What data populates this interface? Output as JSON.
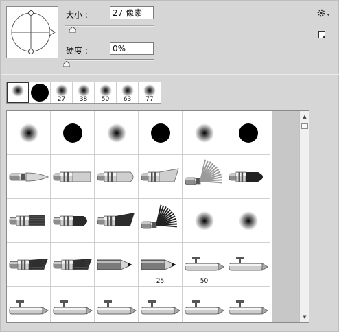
{
  "brush_settings": {
    "size_label": "大小 :",
    "size_value": "27 像素",
    "hardness_label": "硬度 :",
    "hardness_value": "0%",
    "size_slider_fraction": 0.09,
    "hardness_slider_fraction": 0.0
  },
  "icons": {
    "panel_menu": "gear-icon",
    "new_preset": "new-preset-icon"
  },
  "recent_brushes": [
    {
      "kind": "soft",
      "label": "",
      "selected": true
    },
    {
      "kind": "hard",
      "label": ""
    },
    {
      "kind": "soft",
      "label": "27"
    },
    {
      "kind": "soft",
      "label": "38"
    },
    {
      "kind": "soft",
      "label": "50"
    },
    {
      "kind": "soft",
      "label": "63"
    },
    {
      "kind": "soft",
      "label": "77"
    }
  ],
  "presets": [
    {
      "kind": "soft",
      "label": ""
    },
    {
      "kind": "hard",
      "label": ""
    },
    {
      "kind": "soft",
      "label": ""
    },
    {
      "kind": "hard",
      "label": ""
    },
    {
      "kind": "soft",
      "label": ""
    },
    {
      "kind": "hard",
      "label": ""
    },
    {
      "kind": "round-point",
      "label": ""
    },
    {
      "kind": "flat-brush",
      "label": ""
    },
    {
      "kind": "flat-round",
      "label": ""
    },
    {
      "kind": "angled-brush",
      "label": ""
    },
    {
      "kind": "fan",
      "label": ""
    },
    {
      "kind": "round-dark",
      "label": ""
    },
    {
      "kind": "flat-bristle",
      "label": ""
    },
    {
      "kind": "flat-round-dark",
      "label": ""
    },
    {
      "kind": "angled-dark",
      "label": ""
    },
    {
      "kind": "fan-dark",
      "label": ""
    },
    {
      "kind": "soft",
      "label": ""
    },
    {
      "kind": "soft",
      "label": ""
    },
    {
      "kind": "angled-bristle",
      "label": ""
    },
    {
      "kind": "angled-bristle",
      "label": ""
    },
    {
      "kind": "pencil",
      "label": ""
    },
    {
      "kind": "pencil",
      "label": "25"
    },
    {
      "kind": "airbrush",
      "label": "50"
    },
    {
      "kind": "airbrush",
      "label": ""
    },
    {
      "kind": "airbrush",
      "label": ""
    },
    {
      "kind": "airbrush",
      "label": ""
    },
    {
      "kind": "airbrush",
      "label": ""
    },
    {
      "kind": "airbrush",
      "label": ""
    },
    {
      "kind": "airbrush",
      "label": ""
    },
    {
      "kind": "airbrush",
      "label": ""
    }
  ]
}
